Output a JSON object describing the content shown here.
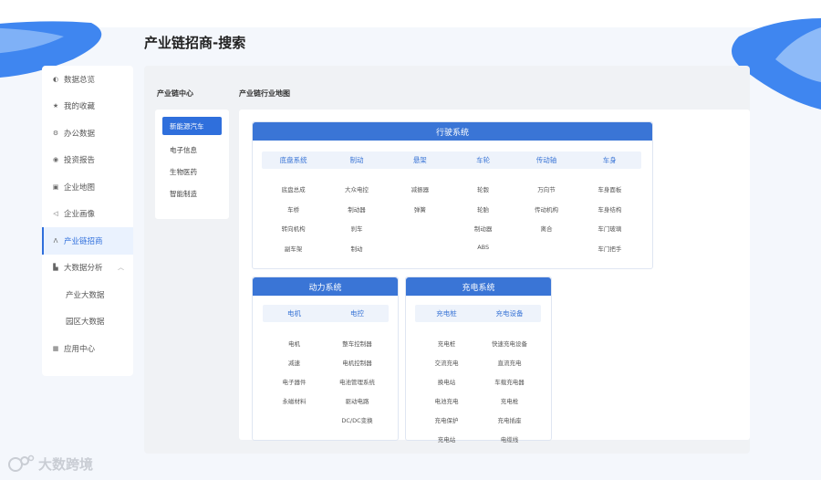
{
  "page": {
    "title": "产业链招商-搜索"
  },
  "sidebar": {
    "items": [
      {
        "label": "数据总览",
        "icon": "chart-icon",
        "active": false
      },
      {
        "label": "我的收藏",
        "icon": "star-icon",
        "active": false
      },
      {
        "label": "办公数据",
        "icon": "gear-icon",
        "active": false
      },
      {
        "label": "投资报告",
        "icon": "report-icon",
        "active": false
      },
      {
        "label": "企业地图",
        "icon": "map-icon",
        "active": false
      },
      {
        "label": "企业画像",
        "icon": "send-icon",
        "active": false
      },
      {
        "label": "产业链招商",
        "icon": "chain-icon",
        "active": true
      },
      {
        "label": "大数据分析",
        "icon": "bar-chart-icon",
        "active": false
      }
    ],
    "subitems": [
      {
        "label": "产业大数据"
      },
      {
        "label": "园区大数据"
      }
    ],
    "last_item": {
      "label": "应用中心",
      "icon": "grid-icon"
    }
  },
  "labels": {
    "center": "产业链中心",
    "map": "产业链行业地图"
  },
  "center_list": [
    {
      "label": "新能源汽车",
      "active": true
    },
    {
      "label": "电子信息",
      "active": false
    },
    {
      "label": "生物医药",
      "active": false
    },
    {
      "label": "智能制造",
      "active": false
    }
  ],
  "systems": {
    "drive": {
      "title": "行驶系统",
      "categories": [
        "底盘系统",
        "制动",
        "悬架",
        "车轮",
        "传动轴",
        "车身"
      ],
      "rows": [
        [
          "底盘总成",
          "大众电控",
          "减振器",
          "轮毂",
          "万向节",
          "车身面板"
        ],
        [
          "车桥",
          "制动器",
          "弹簧",
          "轮胎",
          "传动机构",
          "车身结构"
        ],
        [
          "转向机构",
          "刹车",
          "",
          "制动器",
          "离合",
          "车门玻璃"
        ],
        [
          "副车架",
          "制动",
          "",
          "ABS",
          "",
          "车门把手"
        ]
      ]
    },
    "power": {
      "title": "动力系统",
      "categories": [
        "电机",
        "电控"
      ],
      "rows": [
        [
          "电机",
          "整车控制器"
        ],
        [
          "减速",
          "电机控制器"
        ],
        [
          "电子器件",
          "电池管理系统"
        ],
        [
          "永磁材料",
          "驱动电路"
        ],
        [
          "",
          "DC/DC变换"
        ]
      ]
    },
    "charge": {
      "title": "充电系统",
      "categories": [
        "充电桩",
        "充电设备"
      ],
      "rows": [
        [
          "充电桩",
          "快速充电设备"
        ],
        [
          "交流充电",
          "直流充电"
        ],
        [
          "换电站",
          "车载充电器"
        ],
        [
          "电池充电",
          "充电枪"
        ],
        [
          "充电保护",
          "充电插座"
        ],
        [
          "充电站",
          "电缆线"
        ]
      ]
    }
  },
  "watermark": {
    "text": "大数跨境"
  },
  "colors": {
    "accent": "#3a75d6",
    "active_bg": "#eaf2fe"
  }
}
